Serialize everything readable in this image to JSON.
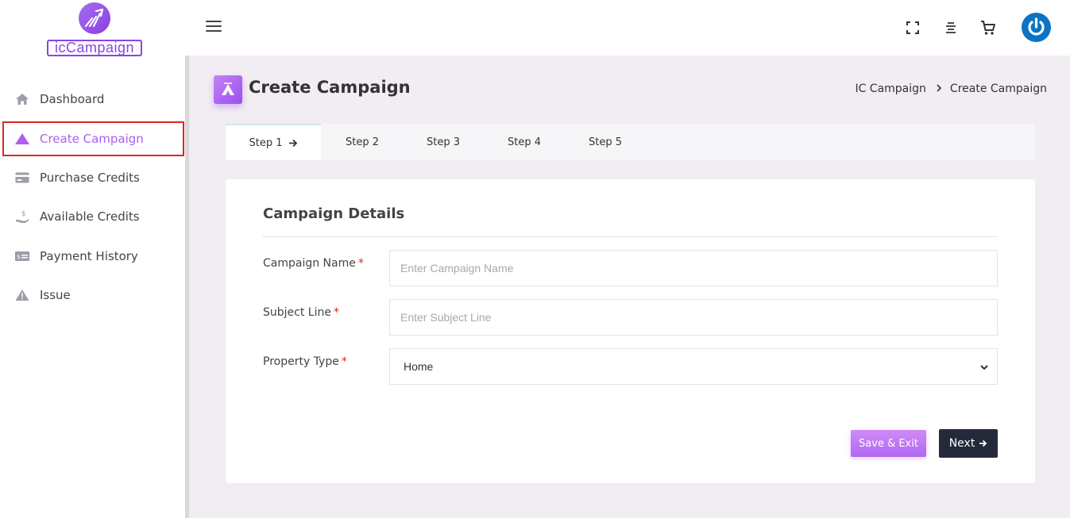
{
  "brand": {
    "logo_text": "icCampaign"
  },
  "sidebar": {
    "items": [
      {
        "label": "Dashboard",
        "icon": "home-icon"
      },
      {
        "label": "Create Campaign",
        "icon": "mountain-icon",
        "active": true
      },
      {
        "label": "Purchase Credits",
        "icon": "credit-card-icon"
      },
      {
        "label": "Available Credits",
        "icon": "hand-coin-icon"
      },
      {
        "label": "Payment History",
        "icon": "money-bill-icon"
      },
      {
        "label": "Issue",
        "icon": "warning-icon"
      }
    ]
  },
  "header": {
    "icons": [
      "hamburger-menu-icon",
      "fullscreen-icon",
      "align-center-icon",
      "cart-icon",
      "power-icon"
    ]
  },
  "page": {
    "title": "Create Campaign",
    "breadcrumb": [
      "IC Campaign",
      "Create Campaign"
    ]
  },
  "steps": [
    {
      "label": "Step 1",
      "active": true
    },
    {
      "label": "Step 2"
    },
    {
      "label": "Step 3"
    },
    {
      "label": "Step 4"
    },
    {
      "label": "Step 5"
    }
  ],
  "form": {
    "title": "Campaign Details",
    "required_marker": "*",
    "campaign_name": {
      "label": "Campaign Name",
      "placeholder": "Enter Campaign Name",
      "value": ""
    },
    "subject_line": {
      "label": "Subject Line",
      "placeholder": "Enter Subject Line",
      "value": ""
    },
    "property_type": {
      "label": "Property Type",
      "value": "Home"
    },
    "save_label": "Save & Exit",
    "next_label": "Next"
  },
  "colors": {
    "accent": "#b05ef0",
    "highlight_border": "#e0261f",
    "next_button": "#252a3a",
    "power_button": "#0b74c4"
  }
}
